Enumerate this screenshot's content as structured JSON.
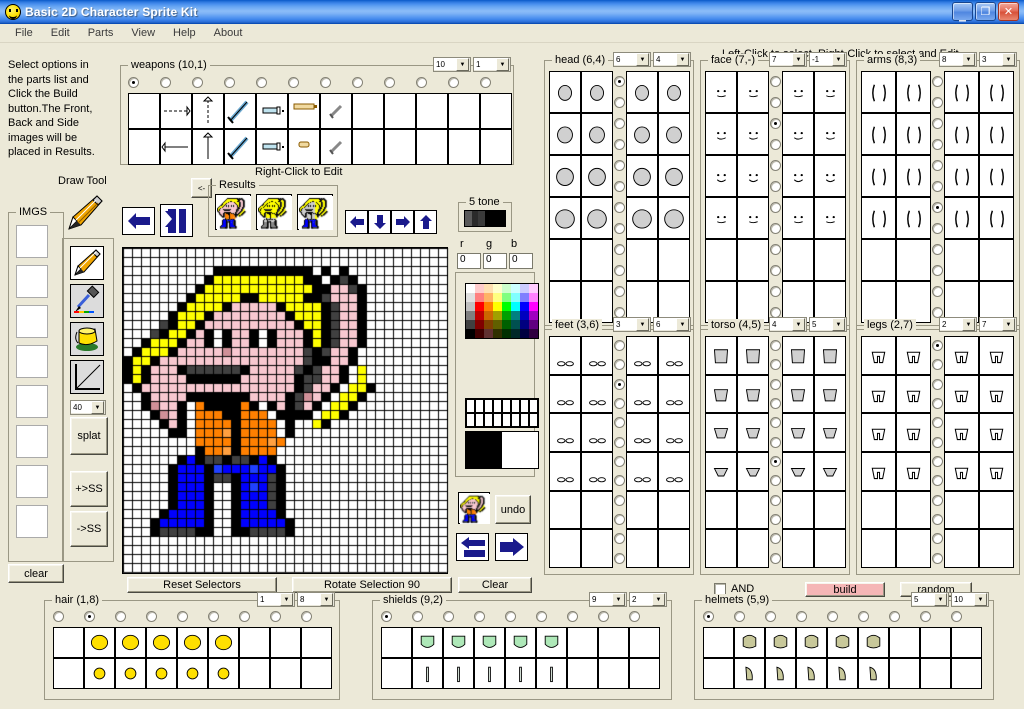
{
  "window": {
    "title": "Basic 2D Character Sprite Kit",
    "icon": "smiley-face-icon",
    "minimize_label": "_",
    "maximize_label": "❐",
    "close_label": "✕"
  },
  "menu": {
    "items": [
      "File",
      "Edit",
      "Parts",
      "View",
      "Help",
      "About"
    ]
  },
  "instructions": "Select options in the parts list and Click the Build button.The Front, Back and Side images will be placed in Results.",
  "left_panel": {
    "draw_tool_label": "Draw Tool",
    "imgs_legend": "IMGS",
    "clear_label": "clear",
    "tools": [
      "pencil-icon",
      "eyedropper-icon",
      "paint-bucket-icon",
      "line-icon"
    ],
    "size_combo": "40",
    "splat_label": "splat",
    "add_ss_label": "+>SS",
    "to_ss_label": "->SS",
    "img_slots": 8
  },
  "weapons": {
    "legend": "weapons (10,1)",
    "combo_a": "10",
    "combo_b": "1",
    "columns": 12,
    "rows": 2,
    "selected_index": 0
  },
  "canvas_area": {
    "right_click_hint": "Right-Click to Edit",
    "back_arrow_icon": "arrow-left-icon",
    "flip_icon": "flip-horizontal-icon",
    "prev_results_label": "<-",
    "results_legend": "Results",
    "results_thumbs": [
      "sprite-front-thumb",
      "sprite-back-thumb",
      "sprite-side-thumb"
    ],
    "nudge_icons": [
      "arrow-left-icon",
      "arrow-down-icon",
      "arrow-right-icon",
      "arrow-up-icon"
    ],
    "reset_selectors_label": "Reset Selectors",
    "rotate_label": "Rotate Selection 90",
    "clear_label": "Clear",
    "undo_label": "undo",
    "swap_left_icon": "swap-left-icon",
    "swap_right_icon": "arrow-right-icon",
    "preview_thumb": "sprite-preview-thumb",
    "grid_cols": 36,
    "grid_rows": 36
  },
  "tone": {
    "legend": "5 tone",
    "r_label": "r",
    "g_label": "g",
    "b_label": "b",
    "r_value": "0",
    "g_value": "0",
    "b_value": "0",
    "fg_color": "#000000",
    "bg_color": "#ffffff"
  },
  "hint_right": "Left-Click to select, Right-Click to select and Edit.",
  "parts_panels": [
    {
      "key": "head",
      "legend": "head (6,4)",
      "combo_a": "6",
      "combo_b": "4",
      "rows": 6,
      "selected_row": 0
    },
    {
      "key": "face",
      "legend": "face (7,-)",
      "combo_a": "7",
      "combo_b": "-1",
      "rows": 6,
      "selected_row": 1
    },
    {
      "key": "arms",
      "legend": "arms (8,3)",
      "combo_a": "8",
      "combo_b": "3",
      "rows": 6,
      "selected_row": 3
    },
    {
      "key": "feet",
      "legend": "feet (3,6)",
      "combo_a": "3",
      "combo_b": "6",
      "rows": 6,
      "selected_row": 1
    },
    {
      "key": "torso",
      "legend": "torso (4,5)",
      "combo_a": "4",
      "combo_b": "5",
      "rows": 6,
      "selected_row": 3
    },
    {
      "key": "legs",
      "legend": "legs (2,7)",
      "combo_a": "2",
      "combo_b": "7",
      "rows": 6,
      "selected_row": 0
    }
  ],
  "build_row": {
    "and_label": "AND",
    "and_checked": false,
    "build_label": "build",
    "build_color": "#f5b6b6",
    "random_label": "random"
  },
  "bottom_panels": [
    {
      "key": "hair",
      "legend": "hair (1,8)",
      "combo_a": "1",
      "combo_b": "8",
      "columns": 9,
      "selected_index": 1
    },
    {
      "key": "shields",
      "legend": "shields (9,2)",
      "combo_a": "9",
      "combo_b": "2",
      "columns": 9,
      "selected_index": 0
    },
    {
      "key": "helmets",
      "legend": "helmets (5,9)",
      "combo_a": "5",
      "combo_b": "10",
      "columns": 9,
      "selected_index": 0
    }
  ],
  "palette": {
    "rows": [
      [
        "#ffffff",
        "#ffcccc",
        "#ffe0b2",
        "#ffffcc",
        "#ccffcc",
        "#ccffff",
        "#ccccff",
        "#ffccff"
      ],
      [
        "#e0e0e0",
        "#ff8080",
        "#ffb366",
        "#ffff80",
        "#80ff80",
        "#80ffff",
        "#8080ff",
        "#ff80ff"
      ],
      [
        "#c0c0c0",
        "#ff0000",
        "#ff8000",
        "#ffff00",
        "#00ff00",
        "#00ffff",
        "#0000ff",
        "#ff00ff"
      ],
      [
        "#808080",
        "#c00000",
        "#cc6600",
        "#a0a000",
        "#00a000",
        "#008080",
        "#0000c0",
        "#a000c0"
      ],
      [
        "#404040",
        "#800000",
        "#804000",
        "#606000",
        "#006000",
        "#005050",
        "#000080",
        "#600080"
      ],
      [
        "#000000",
        "#400000",
        "#603030",
        "#303000",
        "#003000",
        "#002828",
        "#000040",
        "#300040"
      ]
    ]
  }
}
